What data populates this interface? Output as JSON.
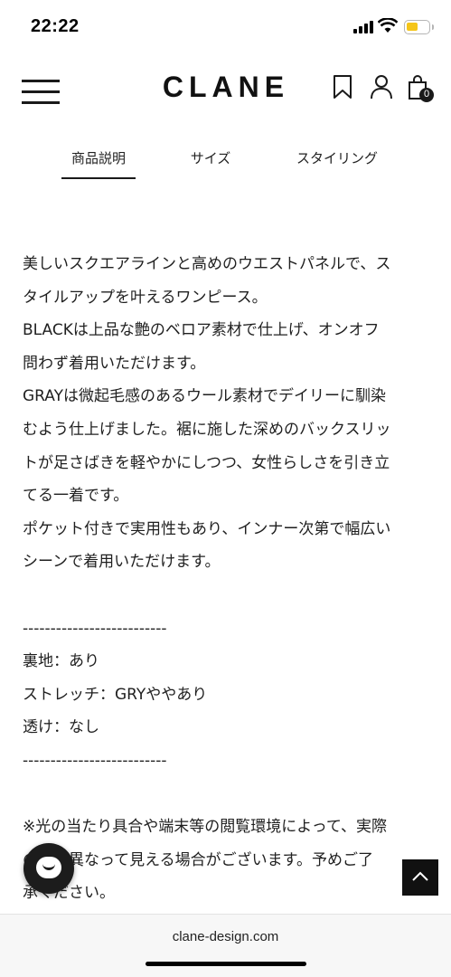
{
  "status": {
    "time": "22:22"
  },
  "header": {
    "logo": "CLANE",
    "cart_count": "0"
  },
  "tabs": [
    {
      "label": "商品説明",
      "active": true
    },
    {
      "label": "サイズ",
      "active": false
    },
    {
      "label": "スタイリング",
      "active": false
    }
  ],
  "description": {
    "lines": [
      "美しいスクエアラインと高めのウエストパネルで、ス",
      "タイルアップを叶えるワンピース。",
      "BLACKは上品な艶のベロア素材で仕上げ、オンオフ",
      "問わず着用いただけます。",
      "GRAYは微起毛感のあるウール素材でデイリーに馴染",
      "むよう仕上げました。裾に施した深めのバックスリッ",
      "トが足さばきを軽やかにしつつ、女性らしさを引き立",
      "てる一着です。",
      "ポケット付きで実用性もあり、インナー次第で幅広い",
      "シーンで着用いただけます。"
    ],
    "divider": "--------------------------",
    "specs": [
      "裏地：あり",
      "ストレッチ：GRYややあり",
      "透け：なし"
    ],
    "note_lines": [
      "※光の当たり具合や端末等の閲覧環境によって、実際",
      "の色と異なって見える場合がございます。予めご了",
      "承ください。"
    ]
  },
  "browser": {
    "url": "clane-design.com"
  },
  "icons": {
    "menu": "hamburger-icon",
    "bookmark": "bookmark-icon",
    "account": "user-icon",
    "cart": "shopping-bag-icon",
    "chat": "chat-icon",
    "scroll_top": "chevron-up-icon"
  },
  "colors": {
    "battery": "#f5c518",
    "text": "#1f1f1f",
    "button_dark": "#111111"
  }
}
